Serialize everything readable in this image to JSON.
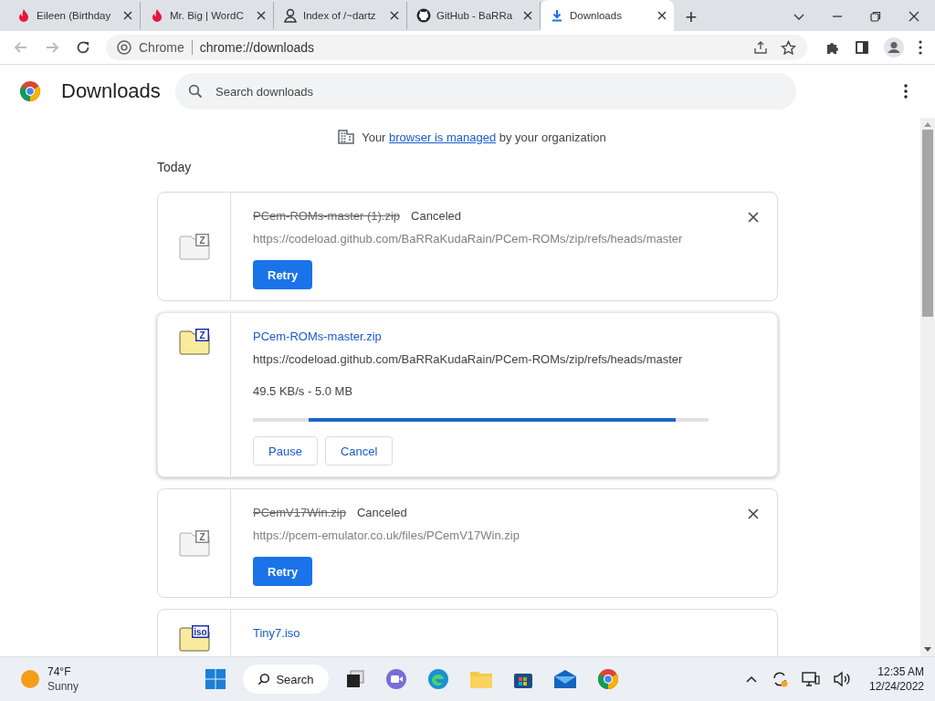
{
  "tabs": [
    {
      "title": "Eileen (Birthday",
      "selected": false
    },
    {
      "title": "Mr. Big | WordC",
      "selected": false
    },
    {
      "title": "Index of /~dartz",
      "selected": false
    },
    {
      "title": "GitHub - BaRRa",
      "selected": false
    },
    {
      "title": "Downloads",
      "selected": true
    }
  ],
  "new_tab": "+",
  "address": {
    "chip": "Chrome",
    "url": "chrome://downloads"
  },
  "page": {
    "title": "Downloads",
    "search": {
      "placeholder": "Search downloads"
    }
  },
  "managed_notice": {
    "before": "Your",
    "link": "browser is managed",
    "after": "by your organization"
  },
  "section": "Today",
  "downloads": [
    {
      "kind": "canceled",
      "file_type": "Z",
      "filename": "PCem-ROMs-master (1).zip",
      "status": "Canceled",
      "url": "https://codeload.github.com/BaRRaKudaRain/PCem-ROMs/zip/refs/heads/master",
      "buttons": [
        {
          "label": "Retry",
          "kind": "primary"
        }
      ]
    },
    {
      "kind": "in_progress",
      "file_type": "Z",
      "filename": "PCem-ROMs-master.zip",
      "url": "https://codeload.github.com/BaRRaKudaRain/PCem-ROMs/zip/refs/heads/master",
      "speed": "49.5 KB/s - 5.0 MB",
      "progress": {
        "indeterminate": true
      },
      "buttons": [
        {
          "label": "Pause",
          "kind": "secondary"
        },
        {
          "label": "Cancel",
          "kind": "secondary"
        }
      ]
    },
    {
      "kind": "canceled",
      "file_type": "Z",
      "filename": "PCemV17Win.zip",
      "status": "Canceled",
      "url": "https://pcem-emulator.co.uk/files/PCemV17Win.zip",
      "buttons": [
        {
          "label": "Retry",
          "kind": "primary"
        }
      ]
    },
    {
      "kind": "complete",
      "file_type": "iso",
      "filename": "Tiny7.iso"
    }
  ],
  "taskbar": {
    "weather": {
      "temp": "74°F",
      "condition": "Sunny"
    },
    "search": "Search",
    "time": "12:35 AM",
    "date": "12/24/2022"
  }
}
